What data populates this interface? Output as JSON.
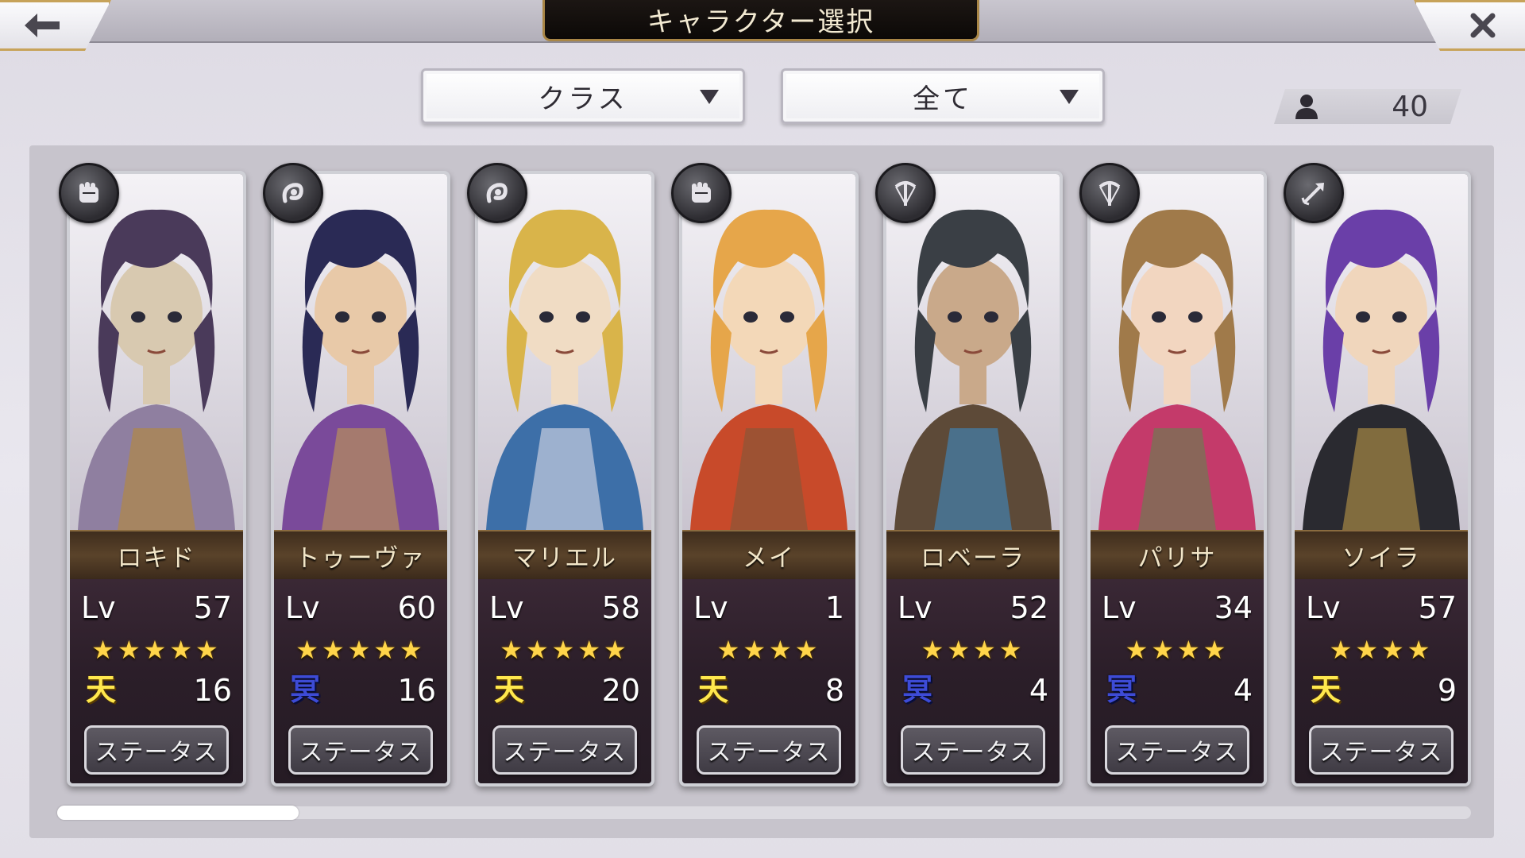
{
  "header": {
    "title": "キャラクター選択"
  },
  "filters": {
    "class_label": "クラス",
    "scope_label": "全て"
  },
  "count": {
    "value": "40"
  },
  "characters": [
    {
      "name": "ロキド",
      "lv_label": "Lv",
      "level": "57",
      "stars": "★★★★★",
      "attr": "天",
      "attr_type": "ten",
      "attr_value": "16",
      "status_label": "ステータス",
      "class_icon": "fist-icon",
      "palette": [
        "#4a3a5a",
        "#8f7fa0",
        "#d8c9b0",
        "#b98a2e"
      ]
    },
    {
      "name": "トゥーヴァ",
      "lv_label": "Lv",
      "level": "60",
      "stars": "★★★★★",
      "attr": "冥",
      "attr_type": "mei",
      "attr_value": "16",
      "status_label": "ステータス",
      "class_icon": "spirit-hand-icon",
      "palette": [
        "#2a2a55",
        "#7a4a9a",
        "#e8c9a8",
        "#c9a24a"
      ]
    },
    {
      "name": "マリエル",
      "lv_label": "Lv",
      "level": "58",
      "stars": "★★★★★",
      "attr": "天",
      "attr_type": "ten",
      "attr_value": "20",
      "status_label": "ステータス",
      "class_icon": "spirit-hand-icon",
      "palette": [
        "#d9b44a",
        "#3d6fa8",
        "#f0dcc4",
        "#ece8ef"
      ]
    },
    {
      "name": "メイ",
      "lv_label": "Lv",
      "level": "1",
      "stars": "★★★★",
      "attr": "天",
      "attr_type": "ten",
      "attr_value": "8",
      "status_label": "ステータス",
      "class_icon": "fist-icon",
      "palette": [
        "#e6a64a",
        "#c84a2a",
        "#f3d8b8",
        "#7a5a3a"
      ]
    },
    {
      "name": "ロベーラ",
      "lv_label": "Lv",
      "level": "52",
      "stars": "★★★★",
      "attr": "冥",
      "attr_type": "mei",
      "attr_value": "4",
      "status_label": "ステータス",
      "class_icon": "crossbow-icon",
      "palette": [
        "#3a3f45",
        "#5d4a38",
        "#c9a98a",
        "#3a8fd0"
      ]
    },
    {
      "name": "パリサ",
      "lv_label": "Lv",
      "level": "34",
      "stars": "★★★★",
      "attr": "冥",
      "attr_type": "mei",
      "attr_value": "4",
      "status_label": "ステータス",
      "class_icon": "crossbow-icon",
      "palette": [
        "#a07a4a",
        "#c43a6a",
        "#f2d6c0",
        "#5a8a4a"
      ]
    },
    {
      "name": "ソイラ",
      "lv_label": "Lv",
      "level": "57",
      "stars": "★★★★",
      "attr": "天",
      "attr_type": "ten",
      "attr_value": "9",
      "status_label": "ステータス",
      "class_icon": "arrow-icon",
      "palette": [
        "#6a3fa8",
        "#2a2a30",
        "#f0d6bc",
        "#c9a24a"
      ]
    }
  ]
}
